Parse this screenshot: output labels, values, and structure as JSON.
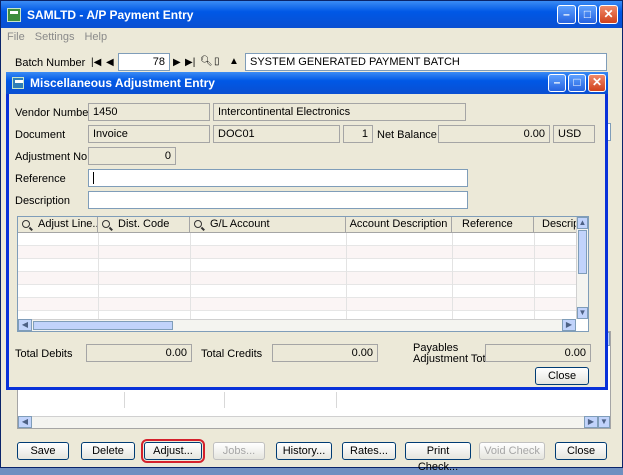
{
  "main_window": {
    "title": "SAMLTD - A/P Payment Entry",
    "menu": [
      "File",
      "Settings",
      "Help"
    ],
    "batch_number_label": "Batch Number",
    "batch_number": "78",
    "batch_description": "SYSTEM GENERATED PAYMENT BATCH",
    "side_value": "2",
    "buttons": {
      "save": "Save",
      "delete": "Delete",
      "adjust": "Adjust...",
      "jobs": "Jobs...",
      "history": "History...",
      "rates": "Rates...",
      "print_check": "Print Check...",
      "void_check": "Void Check",
      "close": "Close"
    }
  },
  "dialog": {
    "title": "Miscellaneous Adjustment Entry",
    "vendor_number_label": "Vendor Number",
    "vendor_number": "1450",
    "vendor_name": "Intercontinental Electronics",
    "document_label": "Document",
    "document_type": "Invoice",
    "document_number": "DOC01",
    "document_seq": "1",
    "net_balance_label": "Net Balance",
    "net_balance": "0.00",
    "currency": "USD",
    "adjustment_no_label": "Adjustment No.",
    "adjustment_no": "0",
    "reference_label": "Reference",
    "reference_value": "",
    "description_label": "Description",
    "description_value": "",
    "grid_columns": [
      "Adjust Line...",
      "Dist. Code",
      "G/L Account",
      "Account Description",
      "Reference",
      "Descriptio"
    ],
    "total_debits_label": "Total Debits",
    "total_debits": "0.00",
    "total_credits_label": "Total Credits",
    "total_credits": "0.00",
    "payables_adjustment_total_label_1": "Payables",
    "payables_adjustment_total_label_2": "Adjustment Total",
    "payables_adjustment_total": "0.00",
    "close_button": "Close"
  }
}
